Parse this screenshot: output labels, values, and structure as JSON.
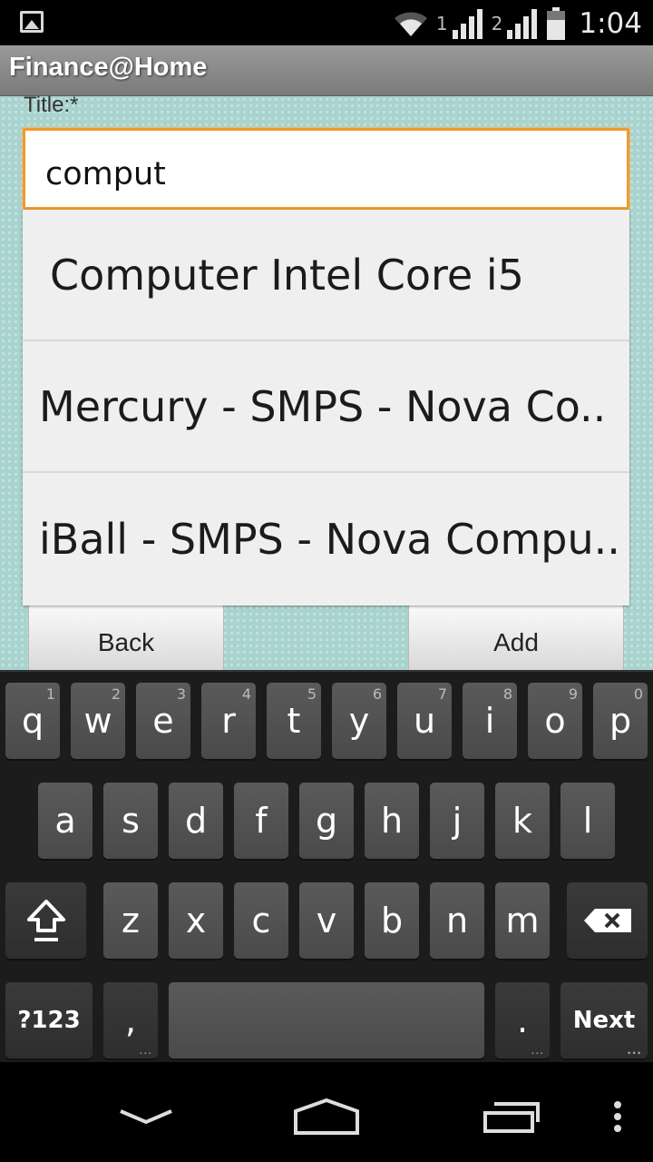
{
  "status_bar": {
    "icons": [
      "image-icon",
      "wifi-icon",
      "signal-icon",
      "signal-icon",
      "battery-icon"
    ],
    "sim1_label": "1",
    "sim2_label": "2",
    "time": "1:04"
  },
  "app": {
    "title": "Finance@Home"
  },
  "form": {
    "title_label": "Title:*",
    "title_value": "comput",
    "back_label": "Back",
    "add_label": "Add",
    "accent_color": "#f29a2c"
  },
  "autocomplete": {
    "items": [
      "Computer Intel Core i5",
      "Mercury - SMPS - Nova Co..",
      "iBall - SMPS - Nova Compu.."
    ]
  },
  "keyboard": {
    "row1": [
      {
        "key": "q",
        "hint": "1"
      },
      {
        "key": "w",
        "hint": "2"
      },
      {
        "key": "e",
        "hint": "3"
      },
      {
        "key": "r",
        "hint": "4"
      },
      {
        "key": "t",
        "hint": "5"
      },
      {
        "key": "y",
        "hint": "6"
      },
      {
        "key": "u",
        "hint": "7"
      },
      {
        "key": "i",
        "hint": "8"
      },
      {
        "key": "o",
        "hint": "9"
      },
      {
        "key": "p",
        "hint": "0"
      }
    ],
    "row2": [
      "a",
      "s",
      "d",
      "f",
      "g",
      "h",
      "j",
      "k",
      "l"
    ],
    "row3": [
      "z",
      "x",
      "c",
      "v",
      "b",
      "n",
      "m"
    ],
    "symbols_label": "?123",
    "comma_label": ",",
    "period_label": ".",
    "next_label": "Next"
  },
  "nav_bar": {
    "icons": [
      "back-down-icon",
      "home-icon",
      "recent-apps-icon",
      "overflow-menu-icon"
    ]
  }
}
